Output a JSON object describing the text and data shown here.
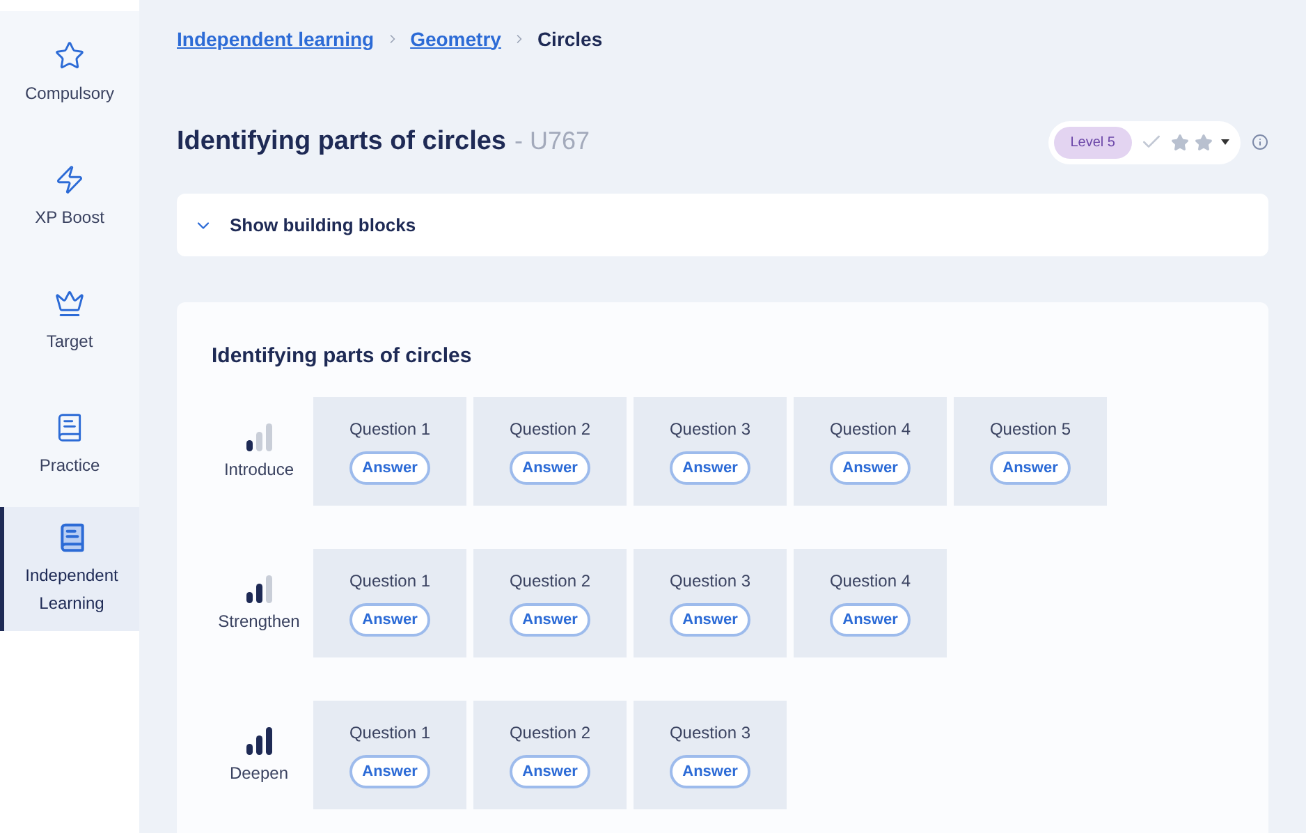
{
  "sidebar": {
    "items": [
      {
        "label": "Compulsory",
        "kind": "star",
        "selected": false
      },
      {
        "label": "XP Boost",
        "kind": "bolt",
        "selected": false
      },
      {
        "label": "Target",
        "kind": "crown",
        "selected": false
      },
      {
        "label": "Practice",
        "kind": "book",
        "selected": false
      },
      {
        "label": "Independent Learning",
        "kind": "book",
        "selected": true
      }
    ]
  },
  "breadcrumb": [
    "Independent learning",
    "Geometry",
    "Circles"
  ],
  "title": "Identifying parts of circles",
  "code": "- U767",
  "status": {
    "level": "Level 5",
    "completed": false
  },
  "building_blocks": {
    "label": "Show building blocks",
    "expanded": false
  },
  "section": {
    "title": "Identifying parts of circles",
    "rows": [
      {
        "kind": "introduce",
        "label": "Introduce",
        "questions": [
          {
            "label": "Question 1",
            "button": "Answer"
          },
          {
            "label": "Question 2",
            "button": "Answer"
          },
          {
            "label": "Question 3",
            "button": "Answer"
          },
          {
            "label": "Question 4",
            "button": "Answer"
          },
          {
            "label": "Question 5",
            "button": "Answer"
          }
        ]
      },
      {
        "kind": "strengthen",
        "label": "Strengthen",
        "questions": [
          {
            "label": "Question 1",
            "button": "Answer"
          },
          {
            "label": "Question 2",
            "button": "Answer"
          },
          {
            "label": "Question 3",
            "button": "Answer"
          },
          {
            "label": "Question 4",
            "button": "Answer"
          }
        ]
      },
      {
        "kind": "deepen",
        "label": "Deepen",
        "questions": [
          {
            "label": "Question 1",
            "button": "Answer"
          },
          {
            "label": "Question 2",
            "button": "Answer"
          },
          {
            "label": "Question 3",
            "button": "Answer"
          }
        ]
      }
    ]
  }
}
